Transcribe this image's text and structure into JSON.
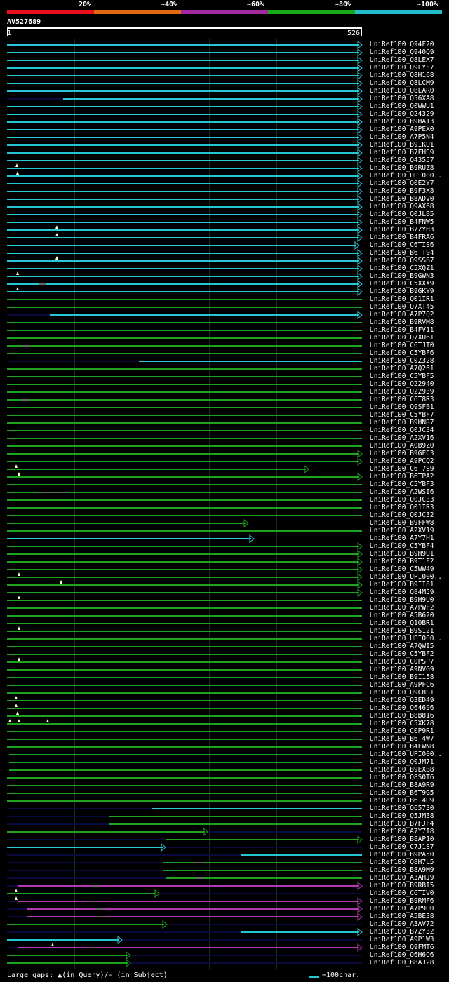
{
  "legend": {
    "labels": [
      "20%",
      "~40%",
      "~60%",
      "~80%",
      "~100%"
    ],
    "colors": [
      "#e8101c",
      "#e06a10",
      "#a02a9e",
      "#18a818",
      "#20bec8"
    ]
  },
  "query": {
    "name": "AV527689",
    "start": "1",
    "end": "526"
  },
  "colors": {
    "cyan": "#25c7d4",
    "green": "#1fa21f",
    "magenta": "#b23ab0",
    "navy": "#0a0a40",
    "gap_gray": "#666666",
    "gap_marker": "#ffffcc"
  },
  "hits": [
    {
      "label": "UniRef100_Q94F20",
      "c": "cyan",
      "s": 10,
      "e": 516,
      "tri": 1
    },
    {
      "label": "UniRef100_Q940Q9",
      "c": "cyan",
      "s": 10,
      "e": 516,
      "tri": 1
    },
    {
      "label": "UniRef100_Q8LEX7",
      "c": "cyan",
      "s": 10,
      "e": 516,
      "tri": 1
    },
    {
      "label": "UniRef100_Q9LYE7",
      "c": "cyan",
      "s": 10,
      "e": 516,
      "tri": 1
    },
    {
      "label": "UniRef100_Q8H168",
      "c": "cyan",
      "s": 10,
      "e": 516,
      "tri": 1
    },
    {
      "label": "UniRef100_Q8LCM9",
      "c": "cyan",
      "s": 10,
      "e": 516,
      "tri": 1
    },
    {
      "label": "UniRef100_Q8LAR0",
      "c": "cyan",
      "s": 10,
      "e": 516,
      "tri": 1
    },
    {
      "label": "UniRef100_Q56XA8",
      "c": "cyan",
      "s": 90,
      "e": 516,
      "tri": 1,
      "pre": true
    },
    {
      "label": "UniRef100_Q0WWU1",
      "c": "cyan",
      "s": 10,
      "e": 516,
      "tri": 1
    },
    {
      "label": "UniRef100_O24329",
      "c": "cyan",
      "s": 10,
      "e": 516,
      "tri": 1
    },
    {
      "label": "UniRef100_B9HA13",
      "c": "cyan",
      "s": 10,
      "e": 516,
      "tri": 1
    },
    {
      "label": "UniRef100_A9PEX0",
      "c": "cyan",
      "s": 10,
      "e": 516,
      "tri": 1
    },
    {
      "label": "UniRef100_A7P5N4",
      "c": "cyan",
      "s": 10,
      "e": 516,
      "tri": 1
    },
    {
      "label": "UniRef100_B9IKU1",
      "c": "cyan",
      "s": 10,
      "e": 516,
      "tri": 1
    },
    {
      "label": "UniRef100_B7FHS9",
      "c": "cyan",
      "s": 10,
      "e": 516,
      "tri": 1
    },
    {
      "label": "UniRef100_Q43557",
      "c": "cyan",
      "s": 10,
      "e": 516,
      "tri": 1
    },
    {
      "label": "UniRef100_B9RUZ8",
      "c": "cyan",
      "s": 10,
      "e": 516,
      "tri": 1,
      "gaps": [
        24
      ]
    },
    {
      "label": "UniRef100_UPI000..",
      "c": "cyan",
      "s": 10,
      "e": 516,
      "tri": 1,
      "gaps": [
        25
      ]
    },
    {
      "label": "UniRef100_Q0E2Y7",
      "c": "cyan",
      "s": 10,
      "e": 516,
      "tri": 1
    },
    {
      "label": "UniRef100_B9F3X8",
      "c": "cyan",
      "s": 10,
      "e": 516,
      "tri": 1
    },
    {
      "label": "UniRef100_B8ADV0",
      "c": "cyan",
      "s": 10,
      "e": 516,
      "tri": 1
    },
    {
      "label": "UniRef100_Q9AX68",
      "c": "cyan",
      "s": 10,
      "e": 516,
      "tri": 1
    },
    {
      "label": "UniRef100_Q0JLB5",
      "c": "cyan",
      "s": 10,
      "e": 516,
      "tri": 1
    },
    {
      "label": "UniRef100_B4FNW5",
      "c": "cyan",
      "s": 10,
      "e": 516,
      "tri": 1
    },
    {
      "label": "UniRef100_B7ZYH3",
      "c": "cyan",
      "s": 10,
      "e": 516,
      "tri": 1,
      "gaps": [
        81
      ]
    },
    {
      "label": "UniRef100_B4FRA6",
      "c": "cyan",
      "s": 10,
      "e": 516,
      "tri": 1,
      "gaps": [
        81
      ]
    },
    {
      "label": "UniRef100_C6TIS6",
      "c": "cyan",
      "s": 10,
      "e": 512,
      "tri": 1
    },
    {
      "label": "UniRef100_B6TT94",
      "c": "cyan",
      "s": 10,
      "e": 516,
      "tri": 1
    },
    {
      "label": "UniRef100_Q9SSB7",
      "c": "cyan",
      "s": 10,
      "e": 516,
      "tri": 1,
      "gaps": [
        81
      ]
    },
    {
      "label": "UniRef100_C5XQZ1",
      "c": "cyan",
      "s": 10,
      "e": 516,
      "tri": 1
    },
    {
      "label": "UniRef100_B9GWN3",
      "c": "cyan",
      "s": 10,
      "e": 516,
      "tri": 1,
      "gaps": [
        25
      ]
    },
    {
      "label": "UniRef100_C5XXX9",
      "c": "cyan",
      "s": 10,
      "e": 516,
      "tri": 1,
      "sgaps": [
        60
      ]
    },
    {
      "label": "UniRef100_B9GKY9",
      "c": "cyan",
      "s": 10,
      "e": 516,
      "tri": 1,
      "gaps": [
        25
      ]
    },
    {
      "label": "UniRef100_Q01IR1",
      "c": "green",
      "s": 10,
      "e": 516,
      "tri": 0
    },
    {
      "label": "UniRef100_Q7XT45",
      "c": "green",
      "s": 10,
      "e": 516,
      "tri": 0
    },
    {
      "label": "UniRef100_A7P7Q2",
      "c": "cyan",
      "s": 71,
      "e": 516,
      "tri": 1,
      "pre": true
    },
    {
      "label": "UniRef100_B9RVM8",
      "c": "green",
      "s": 10,
      "e": 516,
      "tri": 0
    },
    {
      "label": "UniRef100_B4FV11",
      "c": "green",
      "s": 10,
      "e": 516,
      "tri": 0
    },
    {
      "label": "UniRef100_Q7XU61",
      "c": "green",
      "s": 10,
      "e": 516,
      "tri": 0
    },
    {
      "label": "UniRef100_C6TJT0",
      "c": "green",
      "s": 10,
      "e": 516,
      "tri": 0,
      "sgaps": [
        38
      ]
    },
    {
      "label": "UniRef100_C5YBF6",
      "c": "green",
      "s": 10,
      "e": 516,
      "tri": 0
    },
    {
      "label": "UniRef100_C0Z328",
      "c": "cyan",
      "s": 198,
      "e": 516,
      "tri": 0,
      "pre": true
    },
    {
      "label": "UniRef100_A7Q261",
      "c": "green",
      "s": 10,
      "e": 516,
      "tri": 0
    },
    {
      "label": "UniRef100_C5YBF5",
      "c": "green",
      "s": 10,
      "e": 516,
      "tri": 0
    },
    {
      "label": "UniRef100_O22940",
      "c": "green",
      "s": 10,
      "e": 516,
      "tri": 0
    },
    {
      "label": "UniRef100_O22939",
      "c": "green",
      "s": 10,
      "e": 516,
      "tri": 0
    },
    {
      "label": "UniRef100_C6T8R3",
      "c": "green",
      "s": 10,
      "e": 516,
      "tri": 0,
      "sgaps": [
        36
      ]
    },
    {
      "label": "UniRef100_Q9SFB1",
      "c": "green",
      "s": 10,
      "e": 516,
      "tri": 0
    },
    {
      "label": "UniRef100_C5YBF7",
      "c": "green",
      "s": 10,
      "e": 516,
      "tri": 0
    },
    {
      "label": "UniRef100_B9HNR7",
      "c": "green",
      "s": 10,
      "e": 516,
      "tri": 0
    },
    {
      "label": "UniRef100_Q0JC34",
      "c": "green",
      "s": 10,
      "e": 516,
      "tri": 0
    },
    {
      "label": "UniRef100_A2XV16",
      "c": "green",
      "s": 10,
      "e": 516,
      "tri": 0
    },
    {
      "label": "UniRef100_A0B9Z0",
      "c": "green",
      "s": 10,
      "e": 516,
      "tri": 0
    },
    {
      "label": "UniRef100_B9GFC3",
      "c": "green",
      "s": 10,
      "e": 516,
      "tri": 1
    },
    {
      "label": "UniRef100_A9PCQ2",
      "c": "green",
      "s": 10,
      "e": 516,
      "tri": 1
    },
    {
      "label": "UniRef100_C6T7S9",
      "c": "green",
      "s": 10,
      "e": 440,
      "tri": 1,
      "gaps": [
        23
      ]
    },
    {
      "label": "UniRef100_B6TPA2",
      "c": "green",
      "s": 10,
      "e": 516,
      "tri": 1,
      "gaps": [
        27
      ]
    },
    {
      "label": "UniRef100_C5YBF3",
      "c": "green",
      "s": 10,
      "e": 516,
      "tri": 0
    },
    {
      "label": "UniRef100_A2WSI6",
      "c": "green",
      "s": 10,
      "e": 516,
      "tri": 0,
      "sgaps": [
        64,
        78,
        92
      ]
    },
    {
      "label": "UniRef100_Q0JC33",
      "c": "green",
      "s": 10,
      "e": 516,
      "tri": 0
    },
    {
      "label": "UniRef100_Q01IR3",
      "c": "green",
      "s": 10,
      "e": 516,
      "tri": 0
    },
    {
      "label": "UniRef100_Q0JC32",
      "c": "green",
      "s": 10,
      "e": 516,
      "tri": 0
    },
    {
      "label": "UniRef100_B9FFW8",
      "c": "green",
      "s": 10,
      "e": 354,
      "tri": 1
    },
    {
      "label": "UniRef100_A2XV19",
      "c": "green",
      "s": 10,
      "e": 516,
      "tri": 0
    },
    {
      "label": "UniRef100_A7Y7H1",
      "c": "cyan",
      "s": 10,
      "e": 362,
      "tri": 1
    },
    {
      "label": "UniRef100_C5YBF4",
      "c": "green",
      "s": 10,
      "e": 516,
      "tri": 1
    },
    {
      "label": "UniRef100_B9H9U1",
      "c": "green",
      "s": 10,
      "e": 516,
      "tri": 1
    },
    {
      "label": "UniRef100_B9T1F2",
      "c": "green",
      "s": 10,
      "e": 516,
      "tri": 1
    },
    {
      "label": "UniRef100_C5WW49",
      "c": "green",
      "s": 10,
      "e": 516,
      "tri": 1
    },
    {
      "label": "UniRef100_UPI000..",
      "c": "green",
      "s": 10,
      "e": 516,
      "tri": 1,
      "gaps": [
        27
      ]
    },
    {
      "label": "UniRef100_B9II81",
      "c": "green",
      "s": 10,
      "e": 516,
      "tri": 1,
      "gaps": [
        87
      ]
    },
    {
      "label": "UniRef100_Q84M59",
      "c": "green",
      "s": 10,
      "e": 516,
      "tri": 1
    },
    {
      "label": "UniRef100_B9H9U0",
      "c": "green",
      "s": 10,
      "e": 516,
      "tri": 0,
      "gaps": [
        27
      ]
    },
    {
      "label": "UniRef100_A7PWF2",
      "c": "green",
      "s": 10,
      "e": 516,
      "tri": 0
    },
    {
      "label": "UniRef100_A5B620",
      "c": "green",
      "s": 10,
      "e": 516,
      "tri": 0
    },
    {
      "label": "UniRef100_Q10BR1",
      "c": "green",
      "s": 10,
      "e": 516,
      "tri": 0
    },
    {
      "label": "UniRef100_B9S121",
      "c": "green",
      "s": 10,
      "e": 516,
      "tri": 0,
      "gaps": [
        27
      ]
    },
    {
      "label": "UniRef100_UPI000..",
      "c": "green",
      "s": 10,
      "e": 516,
      "tri": 0
    },
    {
      "label": "UniRef100_A7QWI5",
      "c": "green",
      "s": 10,
      "e": 516,
      "tri": 0
    },
    {
      "label": "UniRef100_C5YBF2",
      "c": "green",
      "s": 10,
      "e": 516,
      "tri": 0
    },
    {
      "label": "UniRef100_C0PSP7",
      "c": "green",
      "s": 10,
      "e": 516,
      "tri": 0,
      "gaps": [
        27
      ]
    },
    {
      "label": "UniRef100_A9NVG9",
      "c": "green",
      "s": 10,
      "e": 516,
      "tri": 0
    },
    {
      "label": "UniRef100_B9I158",
      "c": "green",
      "s": 10,
      "e": 516,
      "tri": 0
    },
    {
      "label": "UniRef100_A9PFC6",
      "c": "green",
      "s": 10,
      "e": 516,
      "tri": 0
    },
    {
      "label": "UniRef100_Q9C8S1",
      "c": "green",
      "s": 10,
      "e": 516,
      "tri": 0
    },
    {
      "label": "UniRef100_Q3ED49",
      "c": "green",
      "s": 10,
      "e": 516,
      "tri": 0,
      "gaps": [
        23
      ]
    },
    {
      "label": "UniRef100_O64696",
      "c": "green",
      "s": 10,
      "e": 516,
      "tri": 0,
      "gaps": [
        23
      ]
    },
    {
      "label": "UniRef100_B8B816",
      "c": "green",
      "s": 10,
      "e": 516,
      "tri": 0,
      "gaps": [
        25
      ]
    },
    {
      "label": "UniRef100_C5XK78",
      "c": "green",
      "s": 10,
      "e": 516,
      "tri": 0,
      "gaps": [
        14,
        27,
        68
      ]
    },
    {
      "label": "UniRef100_C0P9R1",
      "c": "green",
      "s": 10,
      "e": 516,
      "tri": 0
    },
    {
      "label": "UniRef100_B6T4W7",
      "c": "green",
      "s": 10,
      "e": 516,
      "tri": 0
    },
    {
      "label": "UniRef100_B4FWN8",
      "c": "green",
      "s": 10,
      "e": 516,
      "tri": 0
    },
    {
      "label": "UniRef100_UPI000..",
      "c": "green",
      "s": 13,
      "e": 516,
      "tri": 0
    },
    {
      "label": "UniRef100_Q0JM71",
      "c": "green",
      "s": 13,
      "e": 516,
      "tri": 0
    },
    {
      "label": "UniRef100_B9EXB8",
      "c": "green",
      "s": 13,
      "e": 516,
      "tri": 0
    },
    {
      "label": "UniRef100_Q8S0T6",
      "c": "green",
      "s": 10,
      "e": 516,
      "tri": 0
    },
    {
      "label": "UniRef100_B8A9R9",
      "c": "green",
      "s": 10,
      "e": 516,
      "tri": 0
    },
    {
      "label": "UniRef100_B6T9G5",
      "c": "green",
      "s": 10,
      "e": 516,
      "tri": 0
    },
    {
      "label": "UniRef100_B6T4U9",
      "c": "green",
      "s": 10,
      "e": 516,
      "tri": 0
    },
    {
      "label": "UniRef100_O65730",
      "c": "cyan",
      "s": 216,
      "e": 516,
      "tri": 0,
      "pre": true
    },
    {
      "label": "UniRef100_Q5JM38",
      "c": "green",
      "s": 155,
      "e": 516,
      "tri": 0,
      "pre": true
    },
    {
      "label": "UniRef100_B7FJF4",
      "c": "green",
      "s": 155,
      "e": 516,
      "tri": 0,
      "pre": true
    },
    {
      "label": "UniRef100_A7Y7I8",
      "c": "green",
      "s": 10,
      "e": 296,
      "tri": 1,
      "post": true
    },
    {
      "label": "UniRef100_B8AP10",
      "c": "green",
      "s": 236,
      "e": 516,
      "tri": 1,
      "pre": true
    },
    {
      "label": "UniRef100_C7J1S7",
      "c": "cyan",
      "s": 10,
      "e": 236,
      "tri": 1,
      "post": true
    },
    {
      "label": "UniRef100_B9PA50",
      "c": "cyan",
      "s": 343,
      "e": 516,
      "tri": 0,
      "pre": true
    },
    {
      "label": "UniRef100_Q8H7L5",
      "c": "green",
      "s": 233,
      "e": 516,
      "tri": 0,
      "pre": true,
      "sgaps": [
        283
      ]
    },
    {
      "label": "UniRef100_B8A9M9",
      "c": "green",
      "s": 233,
      "e": 516,
      "tri": 0,
      "pre": true
    },
    {
      "label": "UniRef100_A3AHJ9",
      "c": "green",
      "s": 236,
      "e": 516,
      "tri": 0,
      "pre": true,
      "sgaps": [
        285
      ]
    },
    {
      "label": "UniRef100_B9RBI5",
      "c": "magenta",
      "s": 25,
      "e": 516,
      "tri": 1,
      "pre": true,
      "sgaps": [
        136
      ]
    },
    {
      "label": "UniRef100_C6TIV0",
      "c": "green",
      "s": 10,
      "e": 227,
      "tri": 1,
      "post": true,
      "gaps": [
        23
      ]
    },
    {
      "label": "UniRef100_B9RMF6",
      "c": "magenta",
      "s": 25,
      "e": 516,
      "tri": 1,
      "pre": true,
      "gaps": [
        23
      ],
      "sgaps": [
        134
      ]
    },
    {
      "label": "UniRef100_A7P9U0",
      "c": "magenta",
      "s": 39,
      "e": 516,
      "tri": 1,
      "pre": true,
      "sgaps": [
        142
      ]
    },
    {
      "label": "UniRef100_A5BE38",
      "c": "magenta",
      "s": 39,
      "e": 516,
      "tri": 1,
      "pre": true,
      "sgaps": [
        142
      ]
    },
    {
      "label": "UniRef100_A3AV72",
      "c": "green",
      "s": 10,
      "e": 238,
      "tri": 1,
      "post": true
    },
    {
      "label": "UniRef100_B7ZY32",
      "c": "cyan",
      "s": 343,
      "e": 516,
      "tri": 1,
      "pre": true
    },
    {
      "label": "UniRef100_A9P1W3",
      "c": "cyan",
      "s": 10,
      "e": 174,
      "tri": 1,
      "post": true
    },
    {
      "label": "UniRef100_Q9FMT6",
      "c": "magenta",
      "s": 25,
      "e": 516,
      "tri": 1,
      "pre": true,
      "gaps": [
        75
      ],
      "sgaps": [
        134
      ]
    },
    {
      "label": "UniRef100_Q6H6Q6",
      "c": "green",
      "s": 10,
      "e": 186,
      "tri": 1,
      "post": true
    },
    {
      "label": "UniRef100_B8AJ28",
      "c": "green",
      "s": 10,
      "e": 186,
      "tri": 1,
      "post": true
    }
  ],
  "footer": {
    "gap_text": "Large gaps: ▲(in Query)/- (in Subject)",
    "scale_text": "=100char."
  }
}
